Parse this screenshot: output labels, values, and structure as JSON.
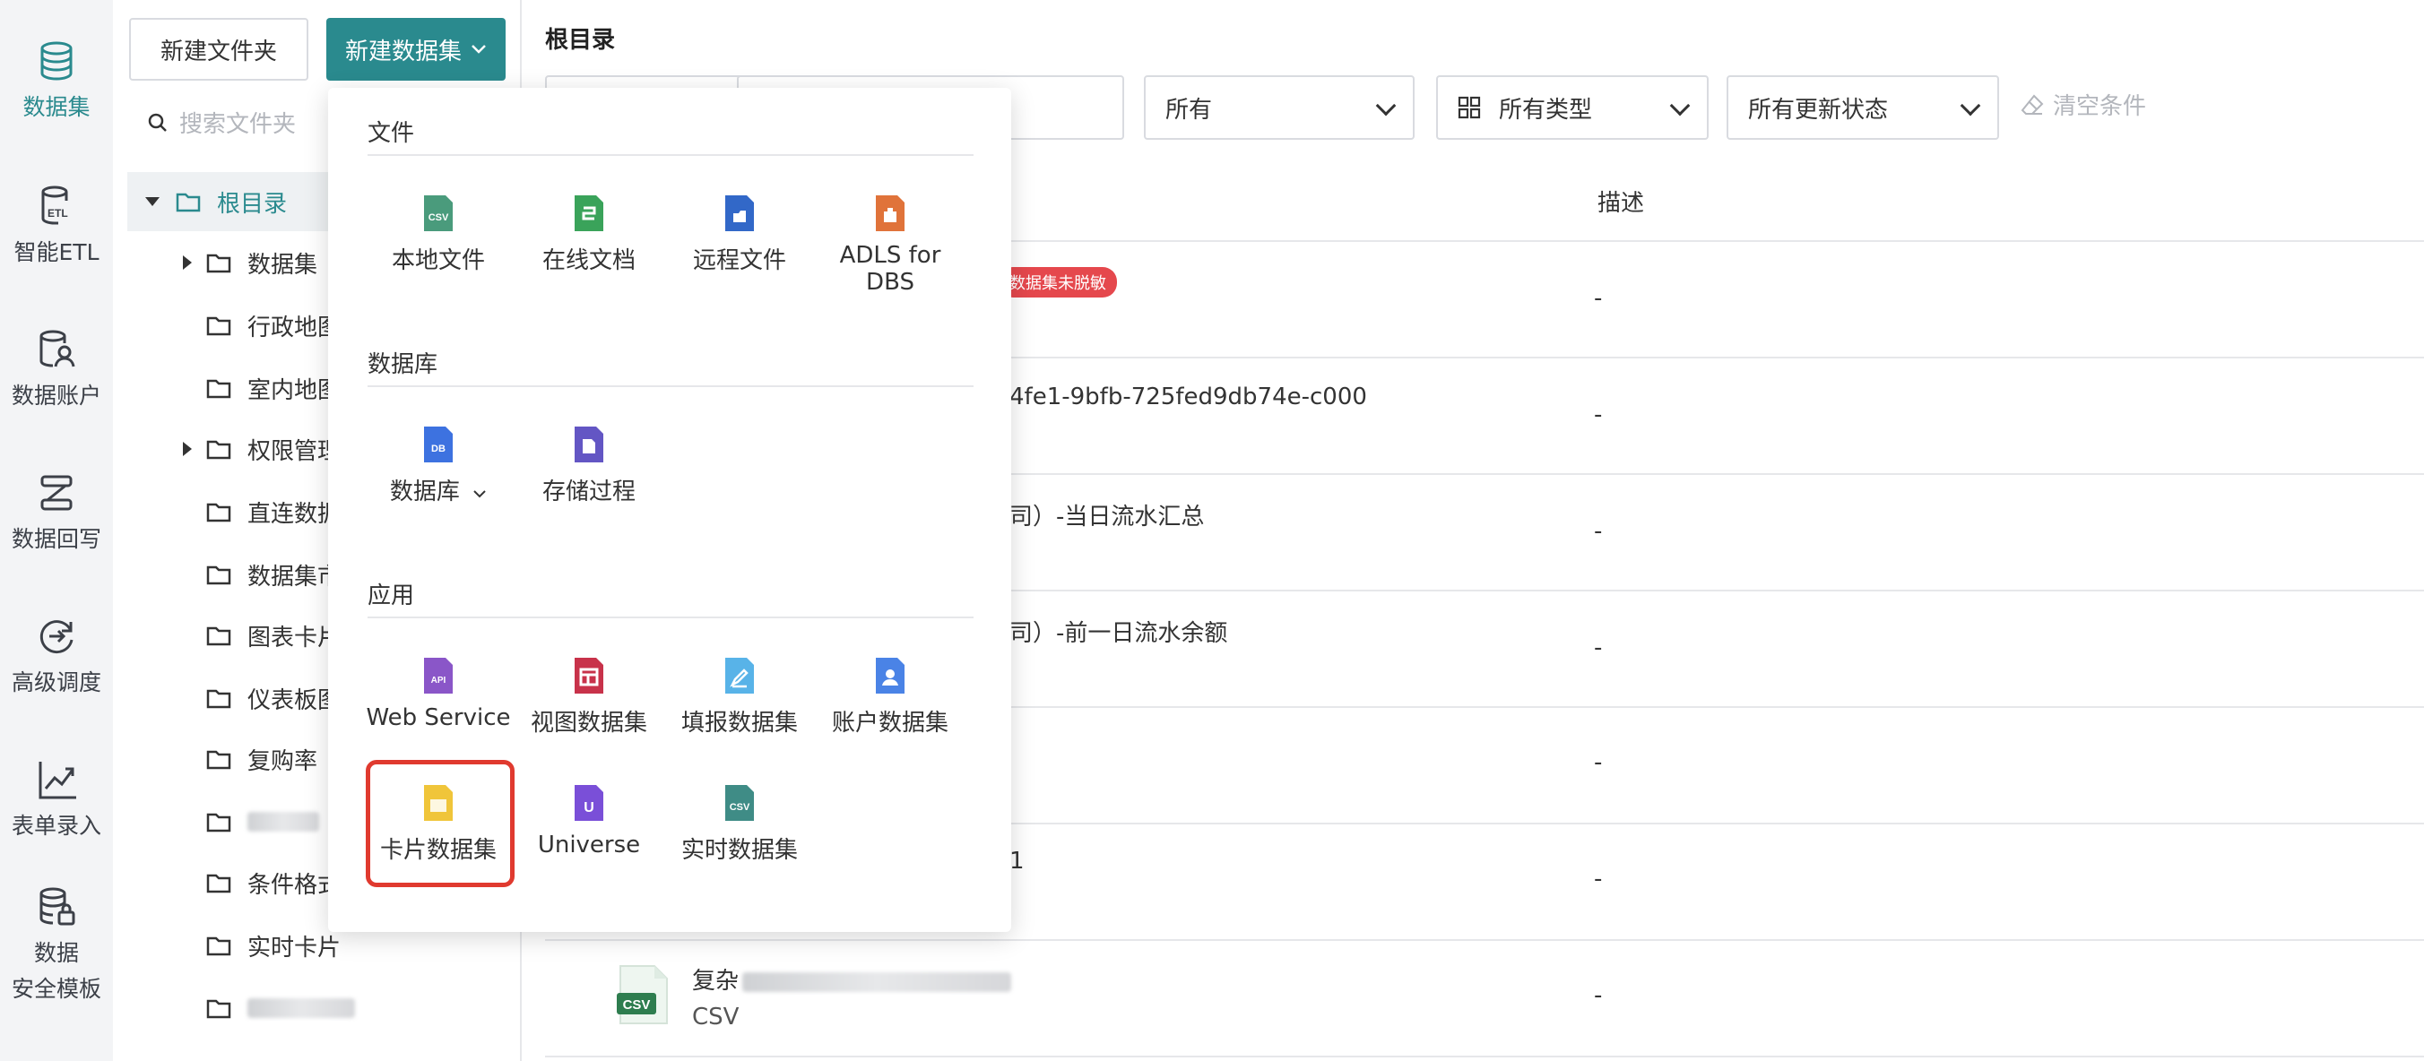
{
  "rail": {
    "items": [
      {
        "label": "数据集",
        "icon": "database-icon"
      },
      {
        "label": "智能ETL",
        "icon": "etl-icon"
      },
      {
        "label": "数据账户",
        "icon": "data-account-icon"
      },
      {
        "label": "数据回写",
        "icon": "data-writeback-icon"
      },
      {
        "label": "高级调度",
        "icon": "schedule-icon"
      },
      {
        "label": "表单录入",
        "icon": "form-entry-icon"
      },
      {
        "label_line1": "数据",
        "label_line2": "安全模板",
        "icon": "security-template-icon"
      }
    ]
  },
  "tree": {
    "new_folder_label": "新建文件夹",
    "new_dataset_label": "新建数据集",
    "search_placeholder": "搜索文件夹",
    "root_label": "根目录",
    "rows": [
      "数据集",
      "行政地图",
      "室内地图",
      "权限管理",
      "直连数据",
      "数据集市",
      "图表卡片",
      "仪表板图",
      "复购率",
      "",
      "条件格式",
      "实时卡片",
      ""
    ]
  },
  "main": {
    "breadcrumb": "根目录",
    "filters": {
      "all": "所有",
      "all_types": "所有类型",
      "all_update_status": "所有更新状态",
      "clear": "清空条件"
    },
    "desc_header": "描述",
    "rows": [
      {
        "text": "",
        "tag": "数据集未脱敏",
        "desc": "-"
      },
      {
        "text": "4fe1-9bfb-725fed9db74e-c000",
        "desc": "-"
      },
      {
        "text": "司）-当日流水汇总",
        "desc": "-"
      },
      {
        "text": "司）-前一日流水余额",
        "desc": "-"
      },
      {
        "text": "",
        "desc": "-"
      },
      {
        "text": "1",
        "desc": "-"
      },
      {
        "text": "复杂",
        "sub": "CSV",
        "desc": "-"
      }
    ]
  },
  "menu": {
    "sections": {
      "file": "文件",
      "database": "数据库",
      "app": "应用"
    },
    "file_items": [
      "本地文件",
      "在线文档",
      "远程文件",
      "ADLS for DBS"
    ],
    "db_items": [
      "数据库",
      "存储过程"
    ],
    "app_items": [
      "Web Service",
      "视图数据集",
      "填报数据集",
      "账户数据集",
      "卡片数据集",
      "Universe",
      "实时数据集"
    ],
    "icon_texts": {
      "csv": "CSV",
      "db": "DB",
      "api": "API",
      "u": "U"
    }
  },
  "colors": {
    "accent": "#2a8a8e",
    "highlight": "#e03a2f"
  }
}
